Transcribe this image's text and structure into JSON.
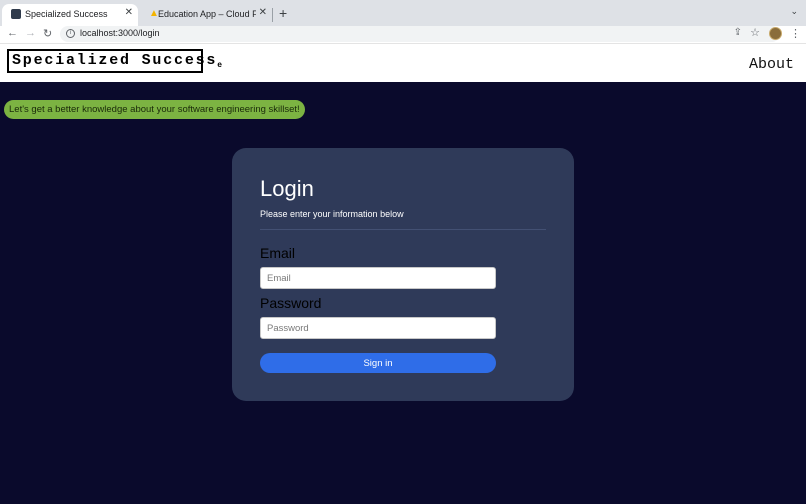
{
  "browser": {
    "tabs": [
      {
        "title": "Specialized Success",
        "active": true
      },
      {
        "title": "Education App – Cloud Firestore",
        "active": false
      }
    ],
    "url": "localhost:3000/login"
  },
  "header": {
    "logo_text": "Specialized Success",
    "logo_mark": "e",
    "about_label": "About"
  },
  "banner": {
    "text": "Let's get a better knowledge about your software engineering skillset!"
  },
  "login": {
    "title": "Login",
    "subtitle": "Please enter your information below",
    "email_label": "Email",
    "email_placeholder": "Email",
    "password_label": "Password",
    "password_placeholder": "Password",
    "signin_label": "Sign in"
  },
  "colors": {
    "page_background": "#0a0a2c",
    "card_background": "#2f3a59",
    "banner_background": "#7cb342",
    "button_background": "#2f6de8"
  }
}
